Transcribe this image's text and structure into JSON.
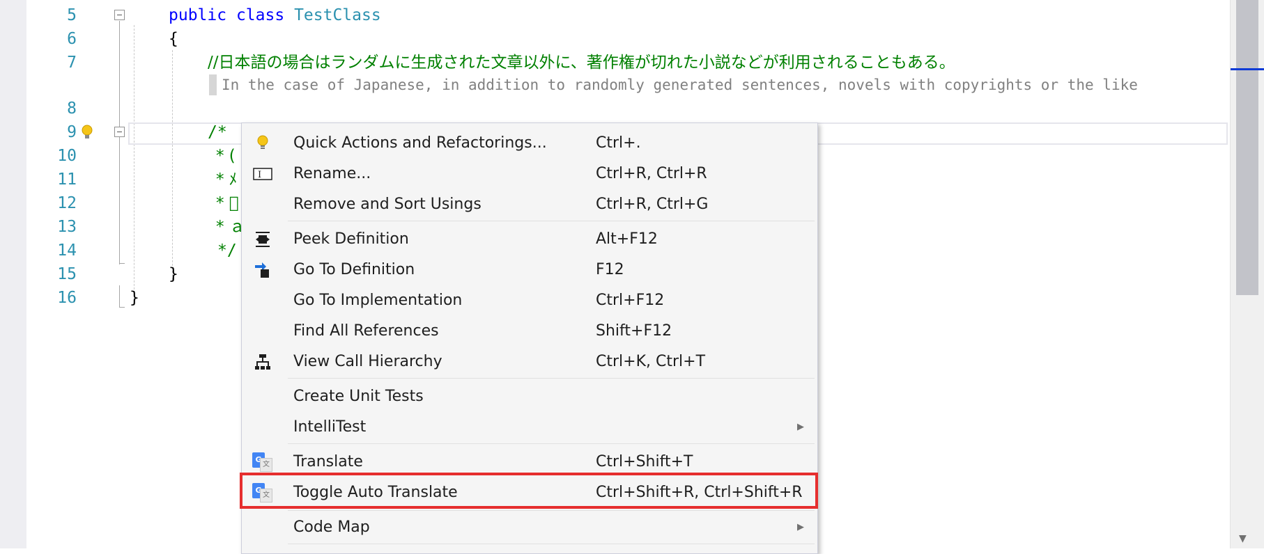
{
  "editor": {
    "lines": [
      {
        "number": "5"
      },
      {
        "number": "6"
      },
      {
        "number": "7"
      },
      {
        "number": "8"
      },
      {
        "number": "9"
      },
      {
        "number": "10"
      },
      {
        "number": "11"
      },
      {
        "number": "12"
      },
      {
        "number": "13"
      },
      {
        "number": "14"
      },
      {
        "number": "15"
      },
      {
        "number": "16"
      }
    ],
    "code": {
      "kw_public": "public",
      "kw_class": "class",
      "class_name": "TestClass",
      "open_brace": "{",
      "comment_jp": "//日本語の場合はランダムに生成された文章以外に、著作権が切れた小説などが利用されることもある。",
      "translation": "In the case of Japanese, in addition to randomly generated sentences, novels with copyrights or the like",
      "block_start": "/*",
      "star_1": "* (",
      "star_2": "* ﾒ",
      "star_3": "* ﾞ",
      "star_4": "* ａ",
      "block_end": "*/",
      "close_brace_inner": "}",
      "close_brace_outer": "}"
    }
  },
  "context_menu": {
    "items": [
      {
        "label": "Quick Actions and Refactorings...",
        "shortcut": "Ctrl+.",
        "icon": "lightbulb-icon"
      },
      {
        "label": "Rename...",
        "shortcut": "Ctrl+R, Ctrl+R",
        "icon": "rename-icon"
      },
      {
        "label": "Remove and Sort Usings",
        "shortcut": "Ctrl+R, Ctrl+G",
        "icon": ""
      },
      {
        "label": "Peek Definition",
        "shortcut": "Alt+F12",
        "icon": "peek-definition-icon"
      },
      {
        "label": "Go To Definition",
        "shortcut": "F12",
        "icon": "go-to-definition-icon"
      },
      {
        "label": "Go To Implementation",
        "shortcut": "Ctrl+F12",
        "icon": ""
      },
      {
        "label": "Find All References",
        "shortcut": "Shift+F12",
        "icon": ""
      },
      {
        "label": "View Call Hierarchy",
        "shortcut": "Ctrl+K, Ctrl+T",
        "icon": "call-hierarchy-icon"
      },
      {
        "label": "Create Unit Tests",
        "shortcut": "",
        "icon": ""
      },
      {
        "label": "IntelliTest",
        "shortcut": "",
        "icon": "",
        "submenu": true
      },
      {
        "label": "Translate",
        "shortcut": "Ctrl+Shift+T",
        "icon": "google-translate-icon"
      },
      {
        "label": "Toggle Auto Translate",
        "shortcut": "Ctrl+Shift+R, Ctrl+Shift+R",
        "icon": "google-translate-icon",
        "highlighted": true
      },
      {
        "label": "Code Map",
        "shortcut": "",
        "icon": "",
        "submenu": true
      }
    ],
    "google_icon_letter": "G",
    "translate_glyph": "文",
    "rename_glyph": "I",
    "submenu_arrow": "▶"
  },
  "colors": {
    "keyword": "#0000ff",
    "type": "#2b91af",
    "comment": "#008000",
    "highlight_border": "#e62e2e",
    "scroll_marker": "#0e3ad6"
  }
}
